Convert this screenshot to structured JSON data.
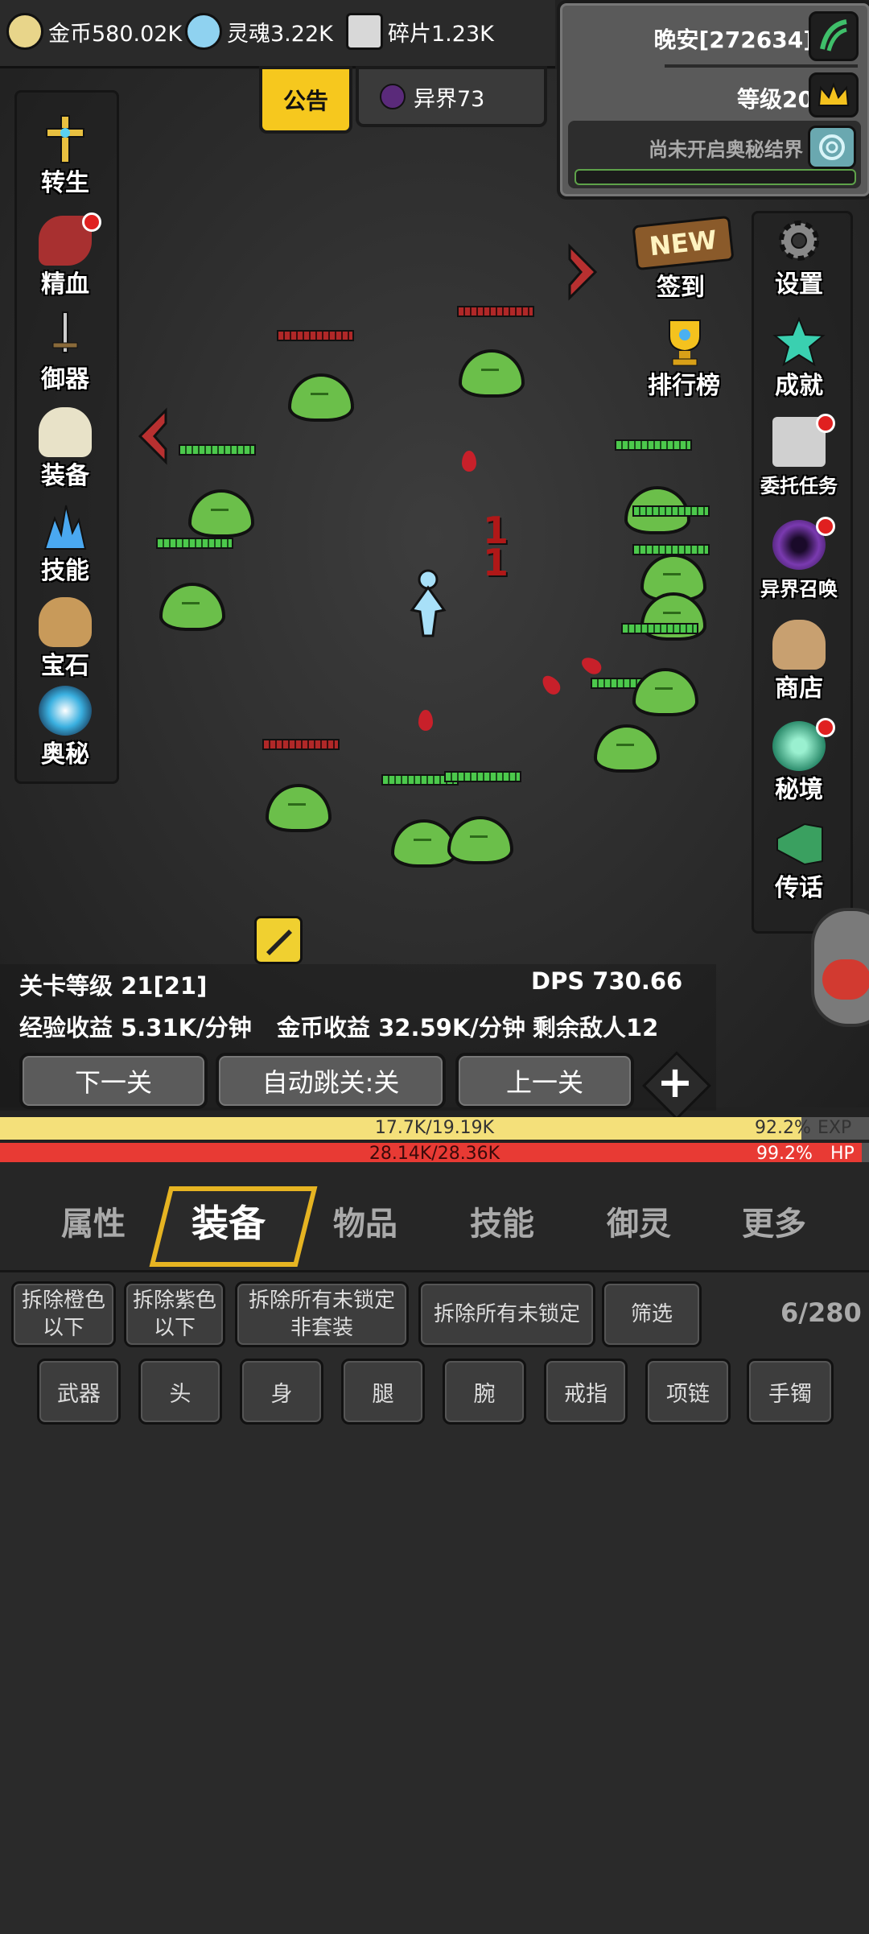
{
  "currencies": [
    {
      "label": "金币580.02K",
      "icon": "gold-coin-icon"
    },
    {
      "label": "灵魂3.22K",
      "icon": "soul-icon"
    },
    {
      "label": "碎片1.23K",
      "icon": "shard-icon"
    }
  ],
  "player": {
    "name": "晚安[272634]",
    "level": "等级20",
    "realm_status": "尚未开启奥秘结界"
  },
  "notice_label": "公告",
  "realm_label": "异界73",
  "left_menu": [
    "转生",
    "精血",
    "御器",
    "装备",
    "技能",
    "宝石",
    "奥秘"
  ],
  "right_menu": [
    "设置",
    "成就",
    "委托任务",
    "异界召唤",
    "商店",
    "秘境",
    "传话"
  ],
  "mid_menu": {
    "signin_badge": "NEW",
    "signin": "签到",
    "leaderboard": "排行榜"
  },
  "damage_numbers": [
    "1",
    "1"
  ],
  "stats": {
    "stage": "关卡等级 21[21]",
    "dps": "DPS 730.66",
    "exp_rate": "经验收益 5.31K/分钟",
    "gold_rate": "金币收益 32.59K/分钟",
    "enemies_left": "剩余敌人12"
  },
  "stage_buttons": {
    "next": "下一关",
    "auto": "自动跳关:关",
    "prev": "上一关",
    "plus": "+"
  },
  "exp_bar": {
    "text": "17.7K/19.19K",
    "percent": "92.2%",
    "label": "EXP",
    "fill": 0.922
  },
  "hp_bar": {
    "text": "28.14K/28.36K",
    "percent": "99.2%",
    "label": "HP",
    "fill": 0.992
  },
  "tabs": [
    "属性",
    "装备",
    "物品",
    "技能",
    "御灵",
    "更多"
  ],
  "active_tab": "装备",
  "filter_buttons": [
    "拆除橙色\n以下",
    "拆除紫色\n以下",
    "拆除所有未锁定\n非套装",
    "拆除所有未锁定",
    "筛选"
  ],
  "inventory_count": "6/280",
  "slots": [
    "武器",
    "头",
    "身",
    "腿",
    "腕",
    "戒指",
    "项链",
    "手镯"
  ],
  "colors": {
    "exp": "#f4e07a",
    "hp": "#e83a34",
    "gold_tab": "#e6b422",
    "slime": "#6bbf4a"
  }
}
